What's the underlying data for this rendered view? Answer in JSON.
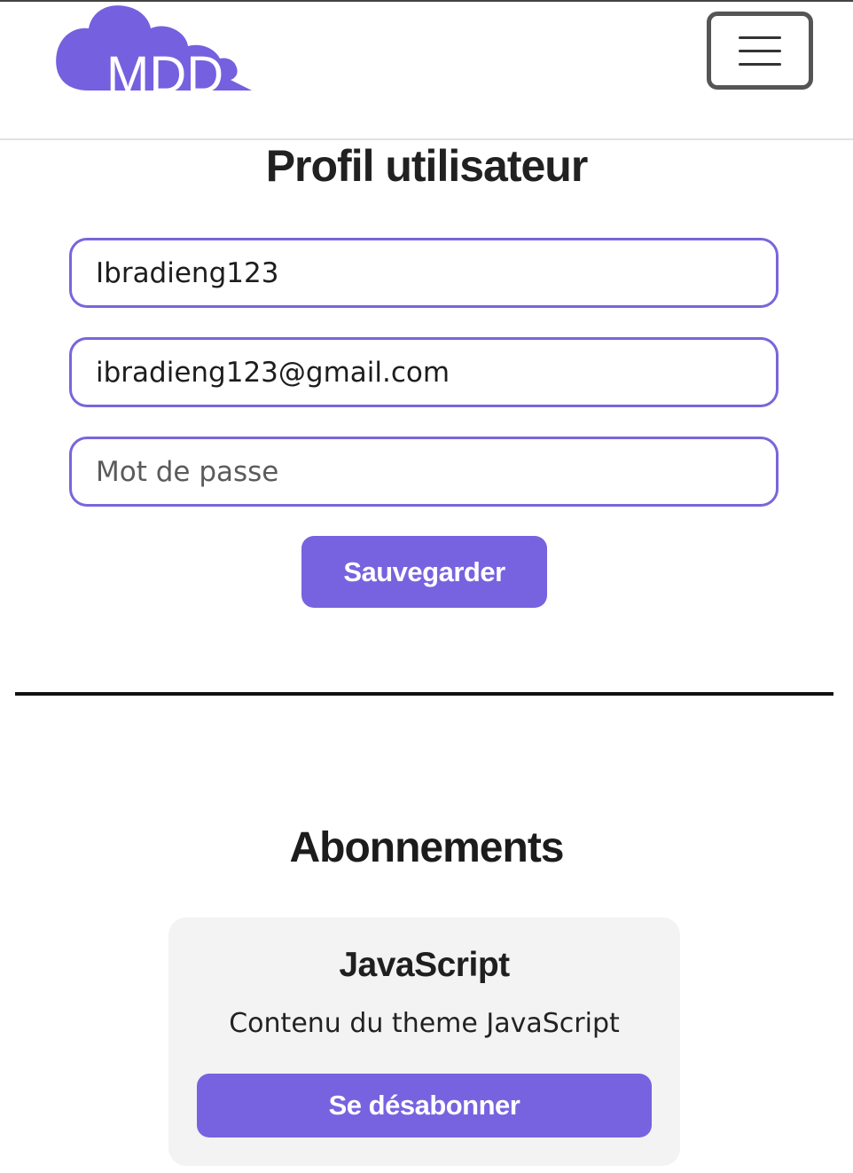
{
  "header": {
    "logo_text": "MDD",
    "menu_icon": "hamburger-icon"
  },
  "profile": {
    "title": "Profil utilisateur",
    "username_value": "Ibradieng123",
    "email_value": "ibradieng123@gmail.com",
    "password_placeholder": "Mot de passe",
    "save_label": "Sauvegarder"
  },
  "subscriptions": {
    "title": "Abonnements",
    "items": [
      {
        "title": "JavaScript",
        "description": "Contenu du theme JavaScript",
        "unsubscribe_label": "Se désabonner"
      }
    ]
  },
  "colors": {
    "accent": "#7763e0",
    "field_border": "#7b64dc",
    "card_bg": "#f3f3f3"
  }
}
